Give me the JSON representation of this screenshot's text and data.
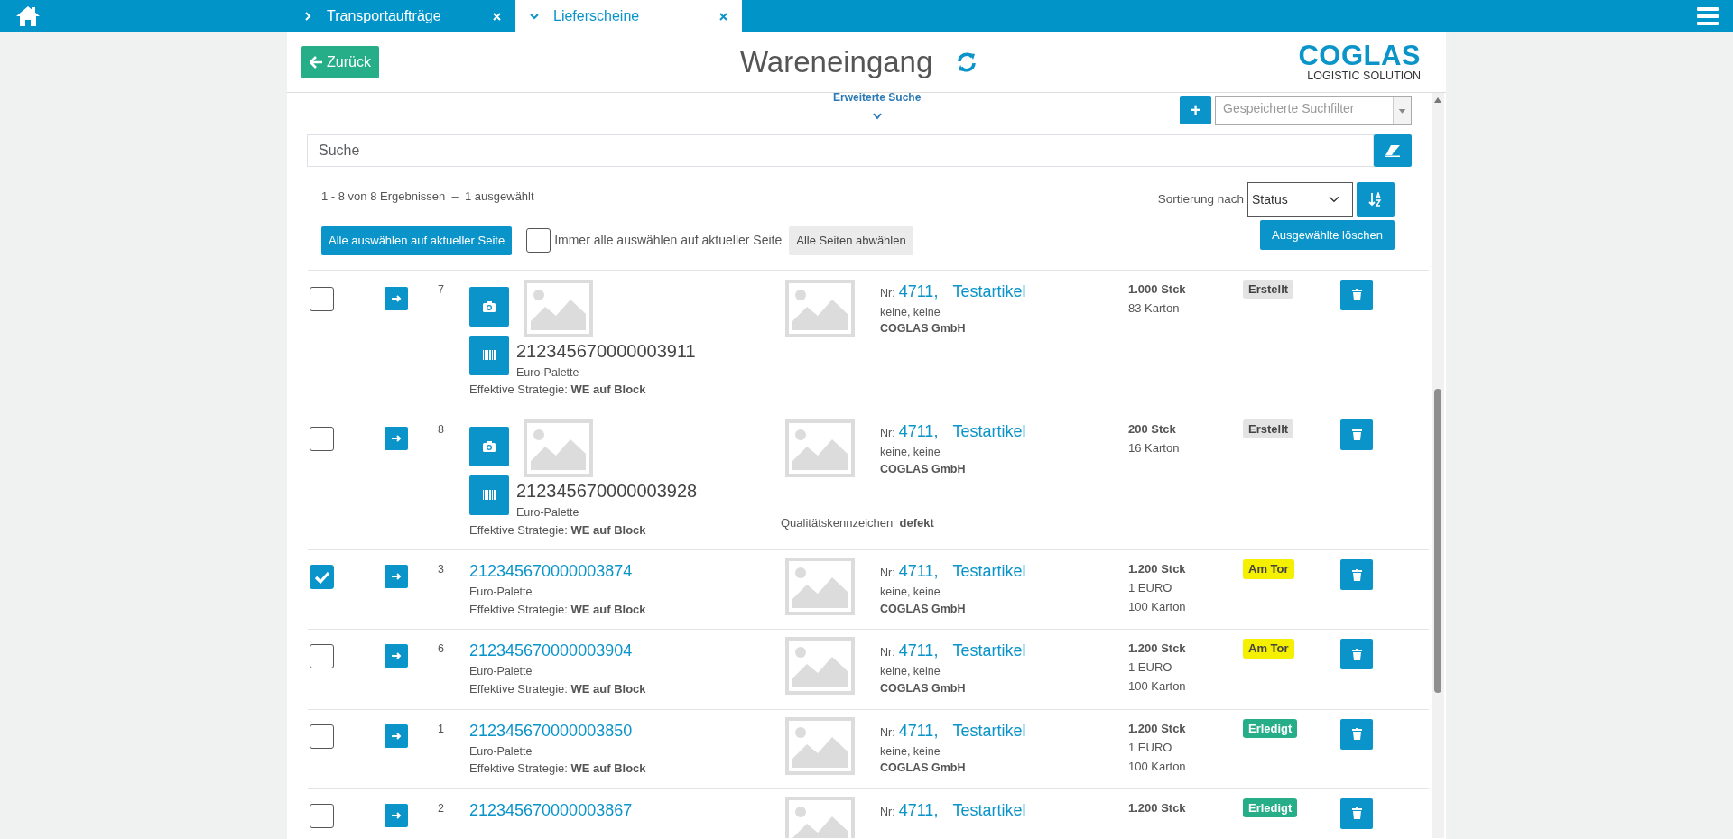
{
  "tabs": [
    {
      "label": "Transportaufträge",
      "selected": false
    },
    {
      "label": "Lieferscheine",
      "selected": true
    }
  ],
  "header": {
    "back_button": "Zurück",
    "title": "Wareneingang",
    "logo_main": "COGLAS",
    "logo_sub": "LOGISTIC SOLUTION"
  },
  "advanced_search": {
    "label": "Erweiterte Suche",
    "expanded": false
  },
  "saved_filter": {
    "add_button": "+",
    "placeholder": "Gespeicherte Suchfilter"
  },
  "search": {
    "placeholder": "Suche"
  },
  "results_info": "1 - 8 von 8 Ergebnissen  –  1 ausgewählt",
  "sort": {
    "label": "Sortierung nach",
    "value": "Status"
  },
  "select_all_button": "Alle auswählen auf aktueller Seite",
  "always_select": {
    "label": "Immer alle auswählen auf aktueller Seite",
    "checked": false
  },
  "deselect_button": "Alle Seiten abwählen",
  "delete_selected_button": "Ausgewählte löschen",
  "rows": [
    {
      "kind": "photo",
      "checked": false,
      "index": "7",
      "id": "212345670000003911",
      "carrier": "Euro-Palette",
      "strategy": "Effektive Strategie: **WE auf Block**",
      "nr_label": "Nr:",
      "number": "4711,",
      "article": "Testartikel",
      "dims": "keine, keine",
      "company": "COGLAS GmbH",
      "quantities": [
        "1.000 Stck",
        "83 Karton"
      ],
      "status": {
        "label": "Erstellt",
        "color": "#e3e3e3"
      }
    },
    {
      "kind": "photo",
      "checked": false,
      "index": "8",
      "id": "212345670000003928",
      "carrier": "Euro-Palette",
      "strategy": "Effektive Strategie: **WE auf Block**",
      "quality": "Qualitätskennzeichen  **defekt**",
      "nr_label": "Nr:",
      "number": "4711,",
      "article": "Testartikel",
      "dims": "keine, keine",
      "company": "COGLAS GmbH",
      "quantities": [
        "200 Stck",
        "16 Karton"
      ],
      "status": {
        "label": "Erstellt",
        "color": "#e3e3e3"
      }
    },
    {
      "kind": "link",
      "checked": true,
      "index": "3",
      "id": "212345670000003874",
      "carrier": "Euro-Palette",
      "strategy": "Effektive Strategie: **WE auf Block**",
      "nr_label": "Nr:",
      "number": "4711,",
      "article": "Testartikel",
      "dims": "keine, keine",
      "company": "COGLAS GmbH",
      "quantities": [
        "1.200 Stck",
        "1 EURO",
        "100 Karton"
      ],
      "status": {
        "label": "Am Tor",
        "color": "#f5f000"
      }
    },
    {
      "kind": "link",
      "checked": false,
      "index": "6",
      "id": "212345670000003904",
      "carrier": "Euro-Palette",
      "strategy": "Effektive Strategie: **WE auf Block**",
      "nr_label": "Nr:",
      "number": "4711,",
      "article": "Testartikel",
      "dims": "keine, keine",
      "company": "COGLAS GmbH",
      "quantities": [
        "1.200 Stck",
        "1 EURO",
        "100 Karton"
      ],
      "status": {
        "label": "Am Tor",
        "color": "#f5f000"
      }
    },
    {
      "kind": "link",
      "checked": false,
      "index": "1",
      "id": "212345670000003850",
      "carrier": "Euro-Palette",
      "strategy": "Effektive Strategie: **WE auf Block**",
      "nr_label": "Nr:",
      "number": "4711,",
      "article": "Testartikel",
      "dims": "keine, keine",
      "company": "COGLAS GmbH",
      "quantities": [
        "1.200 Stck",
        "1 EURO",
        "100 Karton"
      ],
      "status": {
        "label": "Erledigt",
        "color": "#25ae88"
      }
    },
    {
      "kind": "link",
      "checked": false,
      "index": "2",
      "id": "212345670000003867",
      "nr_label": "Nr:",
      "number": "4711,",
      "article": "Testartikel",
      "quantities": [
        "1.200 Stck"
      ],
      "status": {
        "label": "Erledigt",
        "color": "#25ae88"
      }
    }
  ]
}
